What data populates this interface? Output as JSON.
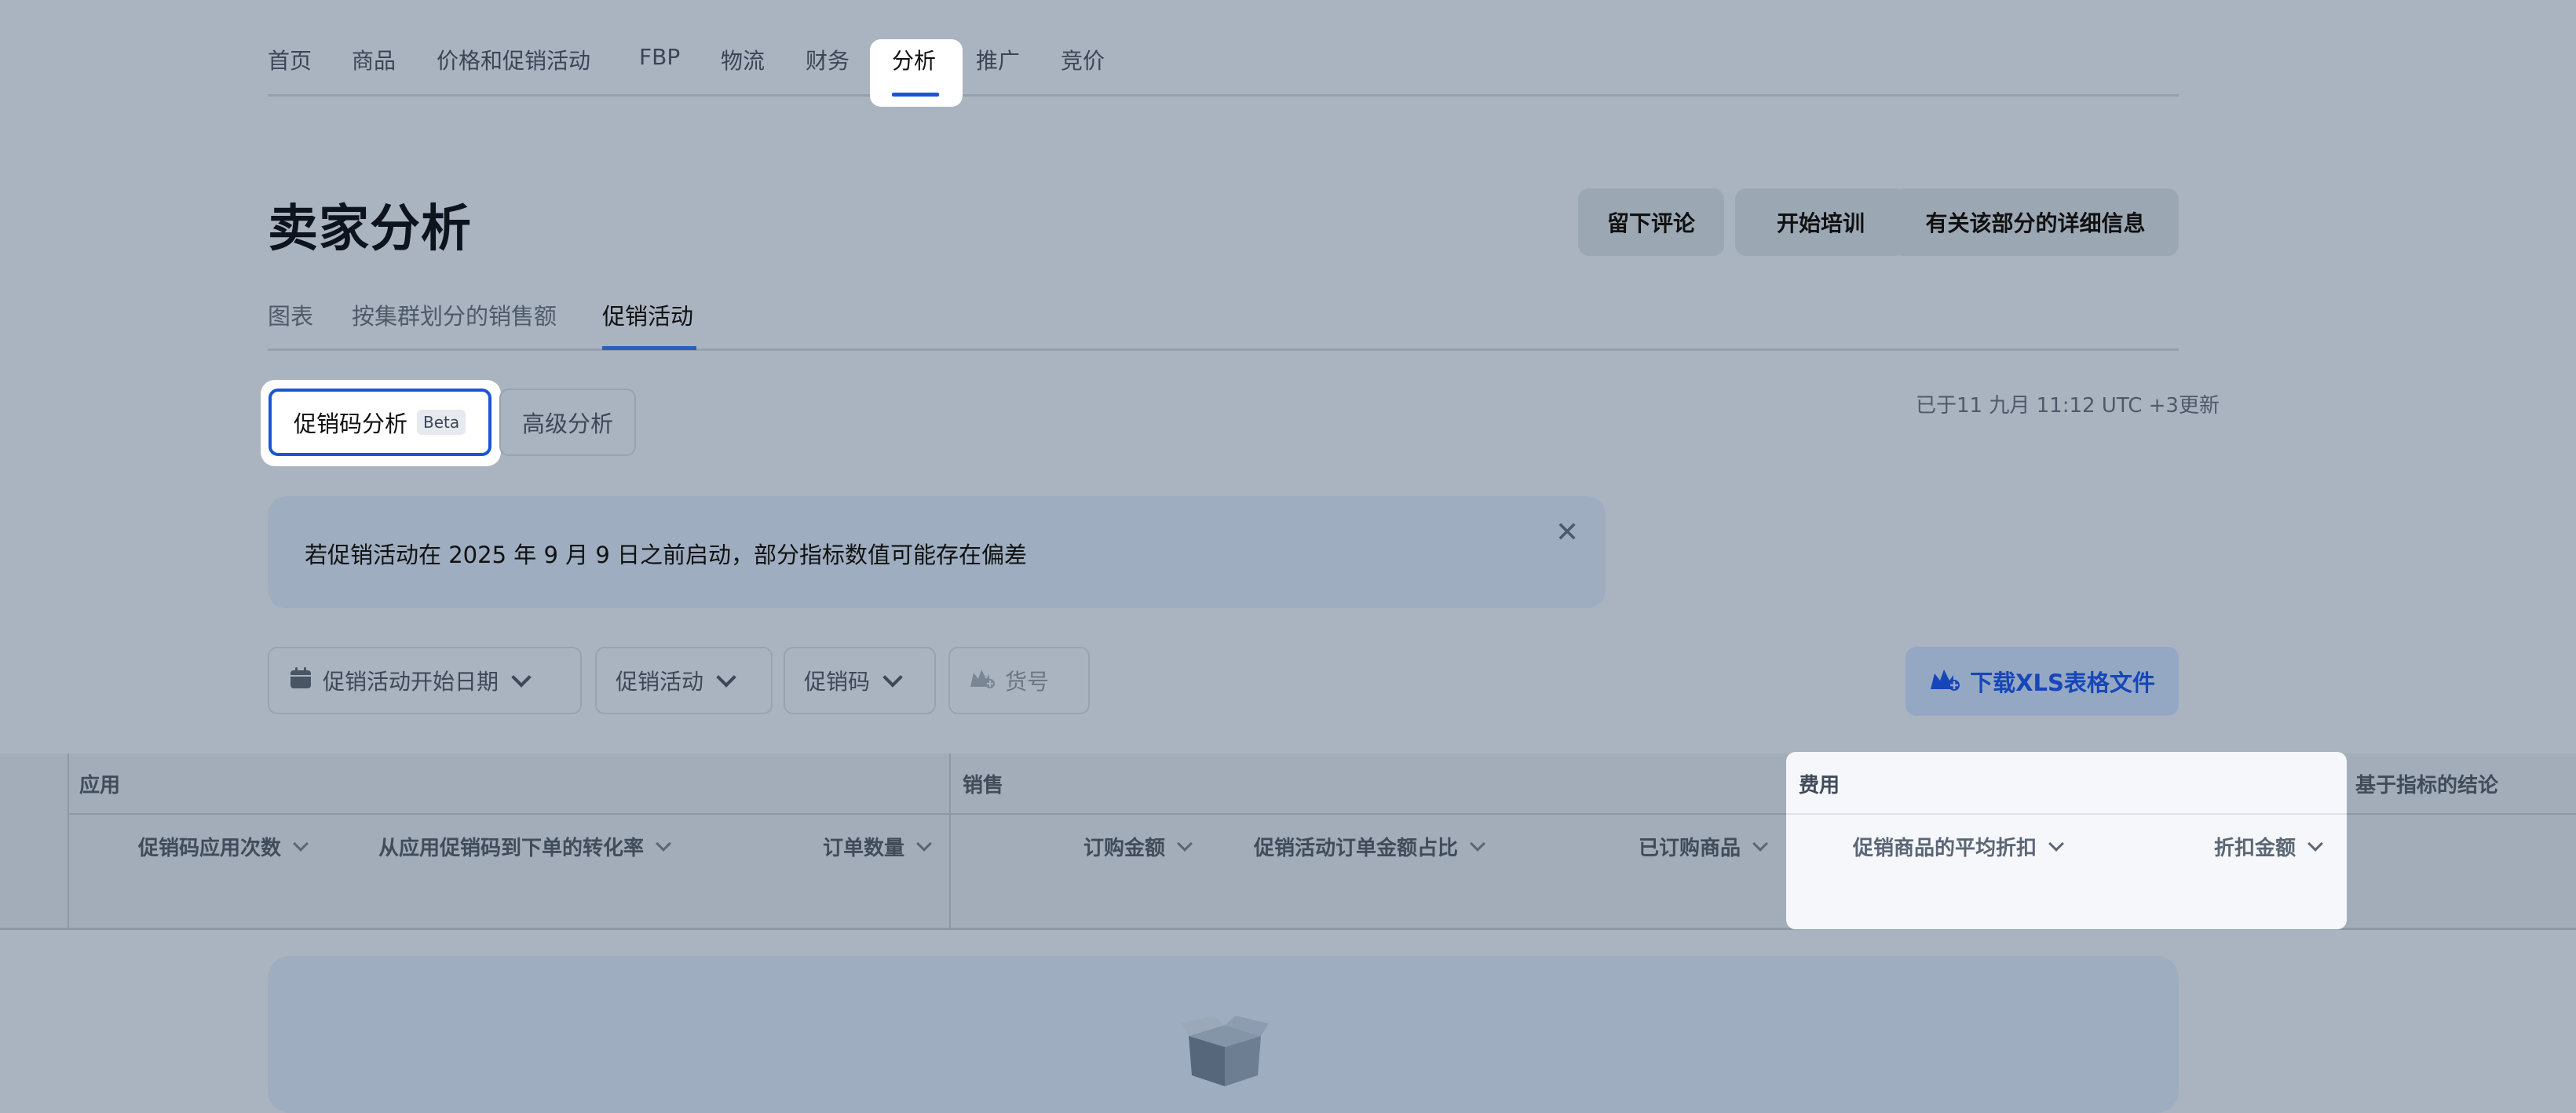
{
  "nav": {
    "items": [
      "首页",
      "商品",
      "价格和促销活动",
      "FBP",
      "物流",
      "财务",
      "分析",
      "推广",
      "竞价"
    ],
    "active": "分析"
  },
  "page": {
    "title": "卖家分析",
    "buttons": [
      "留下评论",
      "开始培训",
      "有关该部分的详细信息"
    ]
  },
  "subtabs": {
    "items": [
      "图表",
      "按集群划分的销售额",
      "促销活动"
    ],
    "active": "促销活动"
  },
  "segment": {
    "active_label": "促销码分析",
    "badge": "Beta",
    "other_label": "高级分析"
  },
  "updated_text": "已于11 九月 11:12 UTC +3更新",
  "banner": {
    "text": "若促销活动在 2025 年 9 月 9 日之前启动，部分指标数值可能存在偏差",
    "close_icon": "close-icon"
  },
  "filters": {
    "start_date": "促销活动开始日期",
    "campaign": "促销活动",
    "promo_code": "促销码",
    "sku": "货号",
    "download": "下载XLS表格文件"
  },
  "table": {
    "groups": {
      "apply": "应用",
      "sales": "销售",
      "cost": "费用",
      "conclusion": "基于指标的结论"
    },
    "columns": {
      "apply_count": "促销码应用次数",
      "conversion": "从应用促销码到下单的转化率",
      "orders": "订单数量",
      "order_amount": "订购金额",
      "share": "促销活动订单金额占比",
      "ordered_items": "已订购商品",
      "avg_discount": "促销商品的平均折扣",
      "discount_amount": "折扣金额"
    }
  },
  "colors": {
    "accent": "#1b55d6",
    "overlay": "#aab4c0"
  }
}
